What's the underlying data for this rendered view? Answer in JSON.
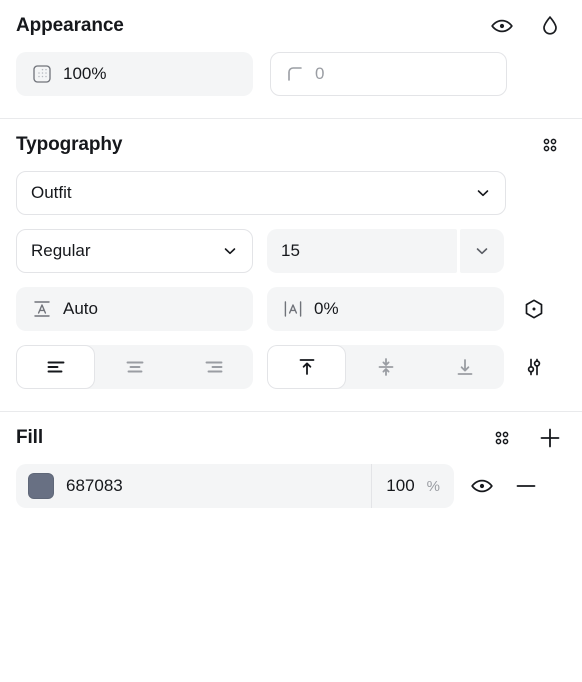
{
  "appearance": {
    "title": "Appearance",
    "visibility_icon": "eye-icon",
    "blend_icon": "droplet-icon",
    "opacity": {
      "icon": "opacity-grid-icon",
      "value": "100%"
    },
    "corner_radius": {
      "icon": "corner-radius-icon",
      "value": "0"
    }
  },
  "typography": {
    "title": "Typography",
    "styles_icon": "four-dots-icon",
    "font_family": {
      "value": "Outfit",
      "chevron": "chevron-down-icon"
    },
    "font_weight": {
      "value": "Regular",
      "chevron": "chevron-down-icon"
    },
    "font_size": {
      "value": "15",
      "chevron": "chevron-down-icon"
    },
    "line_height": {
      "icon": "line-height-icon",
      "value": "Auto"
    },
    "letter_spacing": {
      "icon": "letter-spacing-icon",
      "value": "0%"
    },
    "variable_icon": "hexagon-dot-icon",
    "settings_icon": "sliders-icon",
    "horizontal_align": {
      "options": [
        {
          "name": "align-left",
          "selected": true
        },
        {
          "name": "align-center",
          "selected": false
        },
        {
          "name": "align-right",
          "selected": false
        }
      ]
    },
    "vertical_align": {
      "options": [
        {
          "name": "align-top",
          "selected": true
        },
        {
          "name": "align-middle",
          "selected": false
        },
        {
          "name": "align-bottom",
          "selected": false
        }
      ]
    }
  },
  "fill": {
    "title": "Fill",
    "styles_icon": "four-dots-icon",
    "add_icon": "plus-icon",
    "items": [
      {
        "color": "#687083",
        "hex": "687083",
        "opacity": "100",
        "percent": "%",
        "visibility_icon": "eye-icon",
        "remove_icon": "minus-icon"
      }
    ]
  }
}
